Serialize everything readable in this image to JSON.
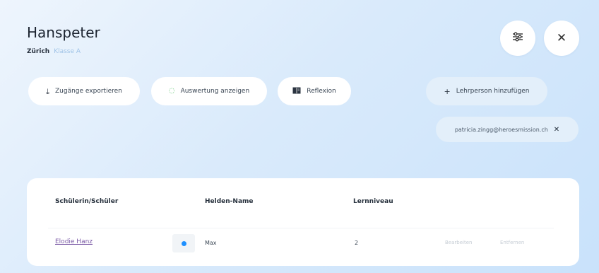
{
  "header": {
    "title": "Hanspeter",
    "city": "Zürich",
    "group": "Klasse A"
  },
  "actions": {
    "export_label": "Zugänge exportieren",
    "evaluation_label": "Auswertung anzeigen",
    "reflection_label": "Reflexion",
    "add_teacher_label": "Lehrperson hinzufügen"
  },
  "teachers": [
    {
      "email": "patricia.zingg@heroesmission.ch"
    }
  ],
  "table": {
    "columns": [
      "Schülerin/Schüler",
      "Helden-Name",
      "Lernniveau"
    ],
    "rows": [
      {
        "student": "Elodie Hanz",
        "hero_name": "Max",
        "level": "2",
        "edit_label": "Bearbeiten",
        "delete_label": "Entfernen"
      }
    ]
  },
  "colors": {
    "accent_dot": "#1e90ff",
    "link": "#7b5aa6",
    "evaluation_icon": "#57c26a"
  },
  "icons": {
    "settings": "sliders-icon",
    "close": "close-icon",
    "export": "download-icon",
    "evaluation": "loading-circle-icon",
    "reflection": "book-icon",
    "add": "plus-icon",
    "remove": "close-icon"
  }
}
